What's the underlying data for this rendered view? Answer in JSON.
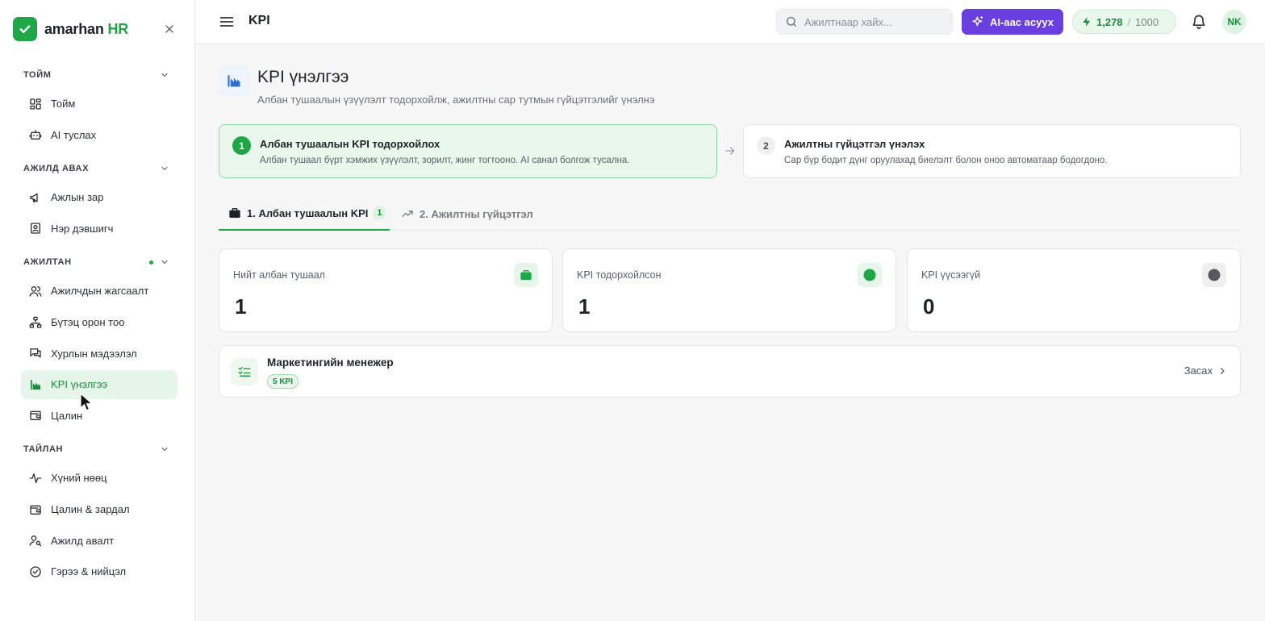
{
  "brand": {
    "name": "amarhan",
    "accent": "HR",
    "color": "#1fa647"
  },
  "sidebar": {
    "sections": [
      {
        "title": "ТОЙМ",
        "items": [
          {
            "label": "Тойм",
            "icon": "dashboard-icon"
          },
          {
            "label": "AI туслах",
            "icon": "robot-icon"
          }
        ]
      },
      {
        "title": "АЖИЛД АВАХ",
        "items": [
          {
            "label": "Ажлын зар",
            "icon": "megaphone-icon"
          },
          {
            "label": "Нэр дэвшигч",
            "icon": "id-badge-icon"
          }
        ]
      },
      {
        "title": "АЖИЛТАН",
        "items": [
          {
            "label": "Ажилчдын жагсаалт",
            "icon": "users-icon"
          },
          {
            "label": "Бүтэц орон тоо",
            "icon": "org-chart-icon"
          },
          {
            "label": "Хурлын мэдээлэл",
            "icon": "chat-icon"
          },
          {
            "label": "KPI үнэлгээ",
            "icon": "bar-chart-icon",
            "active": true
          },
          {
            "label": "Цалин",
            "icon": "wallet-icon"
          }
        ]
      },
      {
        "title": "ТАЙЛАН",
        "items": [
          {
            "label": "Хүний нөөц",
            "icon": "activity-icon"
          },
          {
            "label": "Цалин & зардал",
            "icon": "wallet-icon"
          },
          {
            "label": "Ажилд авалт",
            "icon": "user-search-icon"
          },
          {
            "label": "Гэрээ & нийцэл",
            "icon": "check-circle-icon"
          }
        ]
      }
    ]
  },
  "topbar": {
    "title": "KPI",
    "search_placeholder": "Ажилтнаар хайх...",
    "ai_button": "AI-аас асуух",
    "credits": {
      "used": "1,278",
      "separator": "/",
      "total": "1000"
    },
    "avatar": "NK"
  },
  "page": {
    "title": "KPI үнэлгээ",
    "subtitle": "Албан тушаалын үзүүлэлт тодорхойлж, ажилтны сар тутмын гүйцэтгэлийг үнэлнэ"
  },
  "steps": [
    {
      "num": "1",
      "title": "Албан тушаалын KPI тодорхойлох",
      "desc": "Албан тушаал бүрт хэмжих үзүүлэлт, зорилт, жинг тогтооно. AI санал болгож тусална."
    },
    {
      "num": "2",
      "title": "Ажилтны гүйцэтгэл үнэлэх",
      "desc": "Сар бүр бодит дүнг оруулахад биелэлт болон оноо автоматаар бодогдоно."
    }
  ],
  "tabs": [
    {
      "label": "1. Албан тушаалын KPI",
      "count": "1"
    },
    {
      "label": "2. Ажилтны гүйцэтгэл"
    }
  ],
  "stats": [
    {
      "label": "Нийт албан тушаал",
      "value": "1"
    },
    {
      "label": "KPI тодорхойлсон",
      "value": "1"
    },
    {
      "label": "KPI үүсээгүй",
      "value": "0"
    }
  ],
  "positions": [
    {
      "title": "Маркетингийн менежер",
      "badge": "5 KPI",
      "edit": "Засах"
    }
  ],
  "colors": {
    "primary": "#1fa647",
    "ai": "#6a3fe0",
    "active_bg": "#e6f6ea"
  }
}
